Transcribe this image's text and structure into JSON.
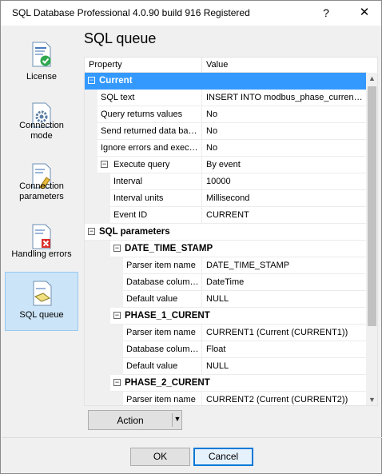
{
  "window": {
    "title": "SQL Database Professional 4.0.90 build 916 Registered",
    "help_glyph": "?",
    "close_glyph": "✕"
  },
  "sidebar": {
    "items": [
      {
        "label": "License",
        "icon": "license-icon"
      },
      {
        "label": "Connection\nmode",
        "icon": "gear-document-icon"
      },
      {
        "label": "Connection\nparameters",
        "icon": "connection-parameters-icon"
      },
      {
        "label": "Handling errors",
        "icon": "error-document-icon"
      },
      {
        "label": "SQL queue",
        "icon": "sql-queue-icon",
        "selected": true
      }
    ]
  },
  "page": {
    "heading": "SQL queue"
  },
  "grid": {
    "header": {
      "property": "Property",
      "value": "Value"
    },
    "rows": [
      {
        "type": "category",
        "name": "Current",
        "selected": true
      },
      {
        "type": "prop",
        "name": "SQL text",
        "value": "INSERT INTO modbus_phase_current..."
      },
      {
        "type": "prop",
        "name": "Query returns values",
        "value": "No"
      },
      {
        "type": "prop",
        "name": "Send returned data bac...",
        "value": "No"
      },
      {
        "type": "prop",
        "name": "Ignore errors and execut...",
        "value": "No"
      },
      {
        "type": "prop-expand",
        "name": "Execute query",
        "value": "By event"
      },
      {
        "type": "subprop",
        "name": "Interval",
        "value": "10000"
      },
      {
        "type": "subprop",
        "name": "Interval units",
        "value": "Millisecond"
      },
      {
        "type": "subprop",
        "name": "Event ID",
        "value": "CURRENT"
      },
      {
        "type": "category",
        "name": "SQL parameters"
      },
      {
        "type": "subcategory",
        "name": "DATE_TIME_STAMP"
      },
      {
        "type": "param",
        "name": "Parser item name",
        "value": "DATE_TIME_STAMP"
      },
      {
        "type": "param",
        "name": "Database column...",
        "value": "DateTime"
      },
      {
        "type": "param",
        "name": "Default value",
        "value": "NULL"
      },
      {
        "type": "subcategory",
        "name": "PHASE_1_CURENT"
      },
      {
        "type": "param",
        "name": "Parser item name",
        "value": "CURRENT1 (Current (CURRENT1))"
      },
      {
        "type": "param",
        "name": "Database column...",
        "value": "Float"
      },
      {
        "type": "param",
        "name": "Default value",
        "value": "NULL"
      },
      {
        "type": "subcategory",
        "name": "PHASE_2_CURENT"
      },
      {
        "type": "param",
        "name": "Parser item name",
        "value": "CURRENT2 (Current (CURRENT2))"
      }
    ]
  },
  "actions": {
    "action_label": "Action",
    "ok_label": "OK",
    "cancel_label": "Cancel"
  },
  "colors": {
    "accent": "#3399ff",
    "selected_nav": "#cce4f7"
  }
}
